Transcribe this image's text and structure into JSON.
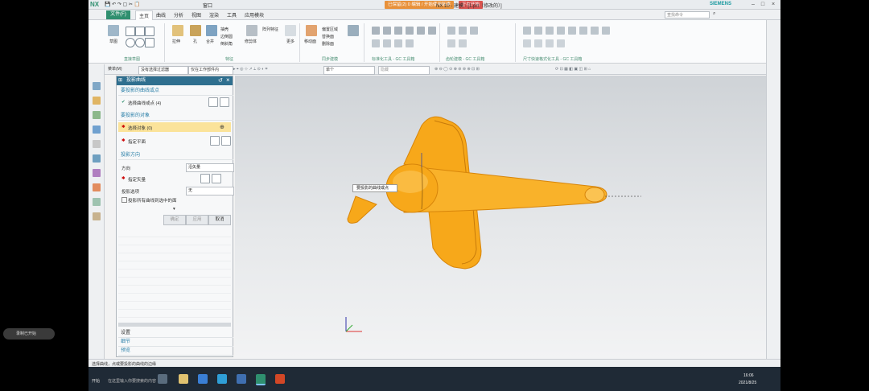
{
  "titlebar": {
    "nx_logo": "NX",
    "window_menu": "窗口",
    "badge_left": "已保留(2) 0 编辑 / 开始使用新建",
    "badge_right": "正在开始",
    "doc_title": "NX 10 - 建模 - [1.prt（修改的）]",
    "brand": "SIEMENS"
  },
  "menu_tabs": {
    "file": "文件(F)",
    "items": [
      "主页",
      "曲线",
      "分析",
      "视图",
      "渲染",
      "工具",
      "应用模块"
    ]
  },
  "search": {
    "placeholder": "查找命令"
  },
  "ribbon": {
    "groups": [
      "直接草图",
      "特征",
      "同步建模",
      "标准化工具 - GC 工具箱",
      "齿轮建模 - GC 工具箱",
      "尺寸快速格式化工具 - GC 工具箱"
    ],
    "labels": {
      "sketch": "草图",
      "extrude": "拉伸",
      "more": "更多",
      "hole": "孔",
      "unite": "合并",
      "shell": "抽壳",
      "edge_blend": "边倒圆",
      "chamfer": "倒斜角",
      "move_face": "移动面",
      "delete_face": "删除面",
      "offset_region": "偏置区域",
      "replace_face": "替换面",
      "trim_body": "修剪体",
      "pattern": "阵列特征"
    }
  },
  "selection_bar": {
    "menu": "菜单(M)",
    "filter": "没有选择过滤器",
    "scope": "仅在工作部件内",
    "snap": "整个装配",
    "view_mode": "单个",
    "layer": "隐藏"
  },
  "dialog": {
    "title": "投影曲线",
    "sec1": "要投影的曲线或点",
    "sec1_row": "选择曲线或点 (4)",
    "sec2": "要投影的对象",
    "sec2_row1": "选择对象 (0)",
    "sec2_row2": "指定平面",
    "sec3": "投影方向",
    "dir_label": "方向",
    "dir_value": "沿矢量",
    "vector_label": "指定矢量",
    "option_label": "投影选项",
    "option_value": "无",
    "checkbox_label": "投影所有曲线到选中的面",
    "btn_ok": "确定",
    "btn_apply": "应用",
    "btn_cancel": "取消",
    "collapsed": [
      "设置",
      "预览",
      "细节"
    ]
  },
  "tooltip": "要投影的曲线或点",
  "overlay": {
    "label": "录制已开始"
  },
  "statusbar": "选择曲线，点或要投影的曲线的边缘",
  "taskbar": {
    "start_label": "开始",
    "search_label": "在这里输入你要搜索的内容",
    "time": "16:06",
    "date": "2021/8/25"
  },
  "colors": {
    "model": "#f7a81a",
    "model_dark": "#e08a0c",
    "accent": "#2f8f6f",
    "dialog_title": "#2f6f8f"
  }
}
